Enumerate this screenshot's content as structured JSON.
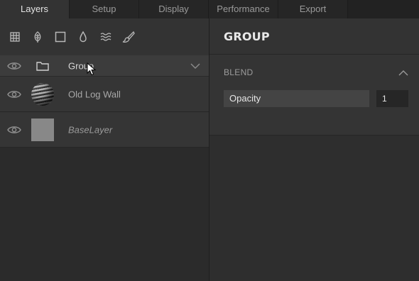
{
  "tabs": [
    {
      "label": "Layers",
      "active": true
    },
    {
      "label": "Setup",
      "active": false
    },
    {
      "label": "Display",
      "active": false
    },
    {
      "label": "Performance",
      "active": false
    },
    {
      "label": "Export",
      "active": false
    }
  ],
  "toolbar": {
    "icons": [
      "grid-icon",
      "leaf-icon",
      "square-icon",
      "drop-icon",
      "waves-icon",
      "brush-icon"
    ]
  },
  "layers": [
    {
      "name": "Group",
      "type": "group",
      "visible": true
    },
    {
      "name": "Old Log Wall",
      "type": "material",
      "visible": true
    },
    {
      "name": "BaseLayer",
      "type": "base",
      "visible": true
    }
  ],
  "panel": {
    "title": "GROUP",
    "blend": {
      "title": "BLEND",
      "opacity_label": "Opacity",
      "opacity_value": "1"
    }
  },
  "colors": {
    "background": "#2b2b2b",
    "panel": "#333333",
    "active_tab": "#333333",
    "field_label": "#444444",
    "field_value": "#262626"
  }
}
